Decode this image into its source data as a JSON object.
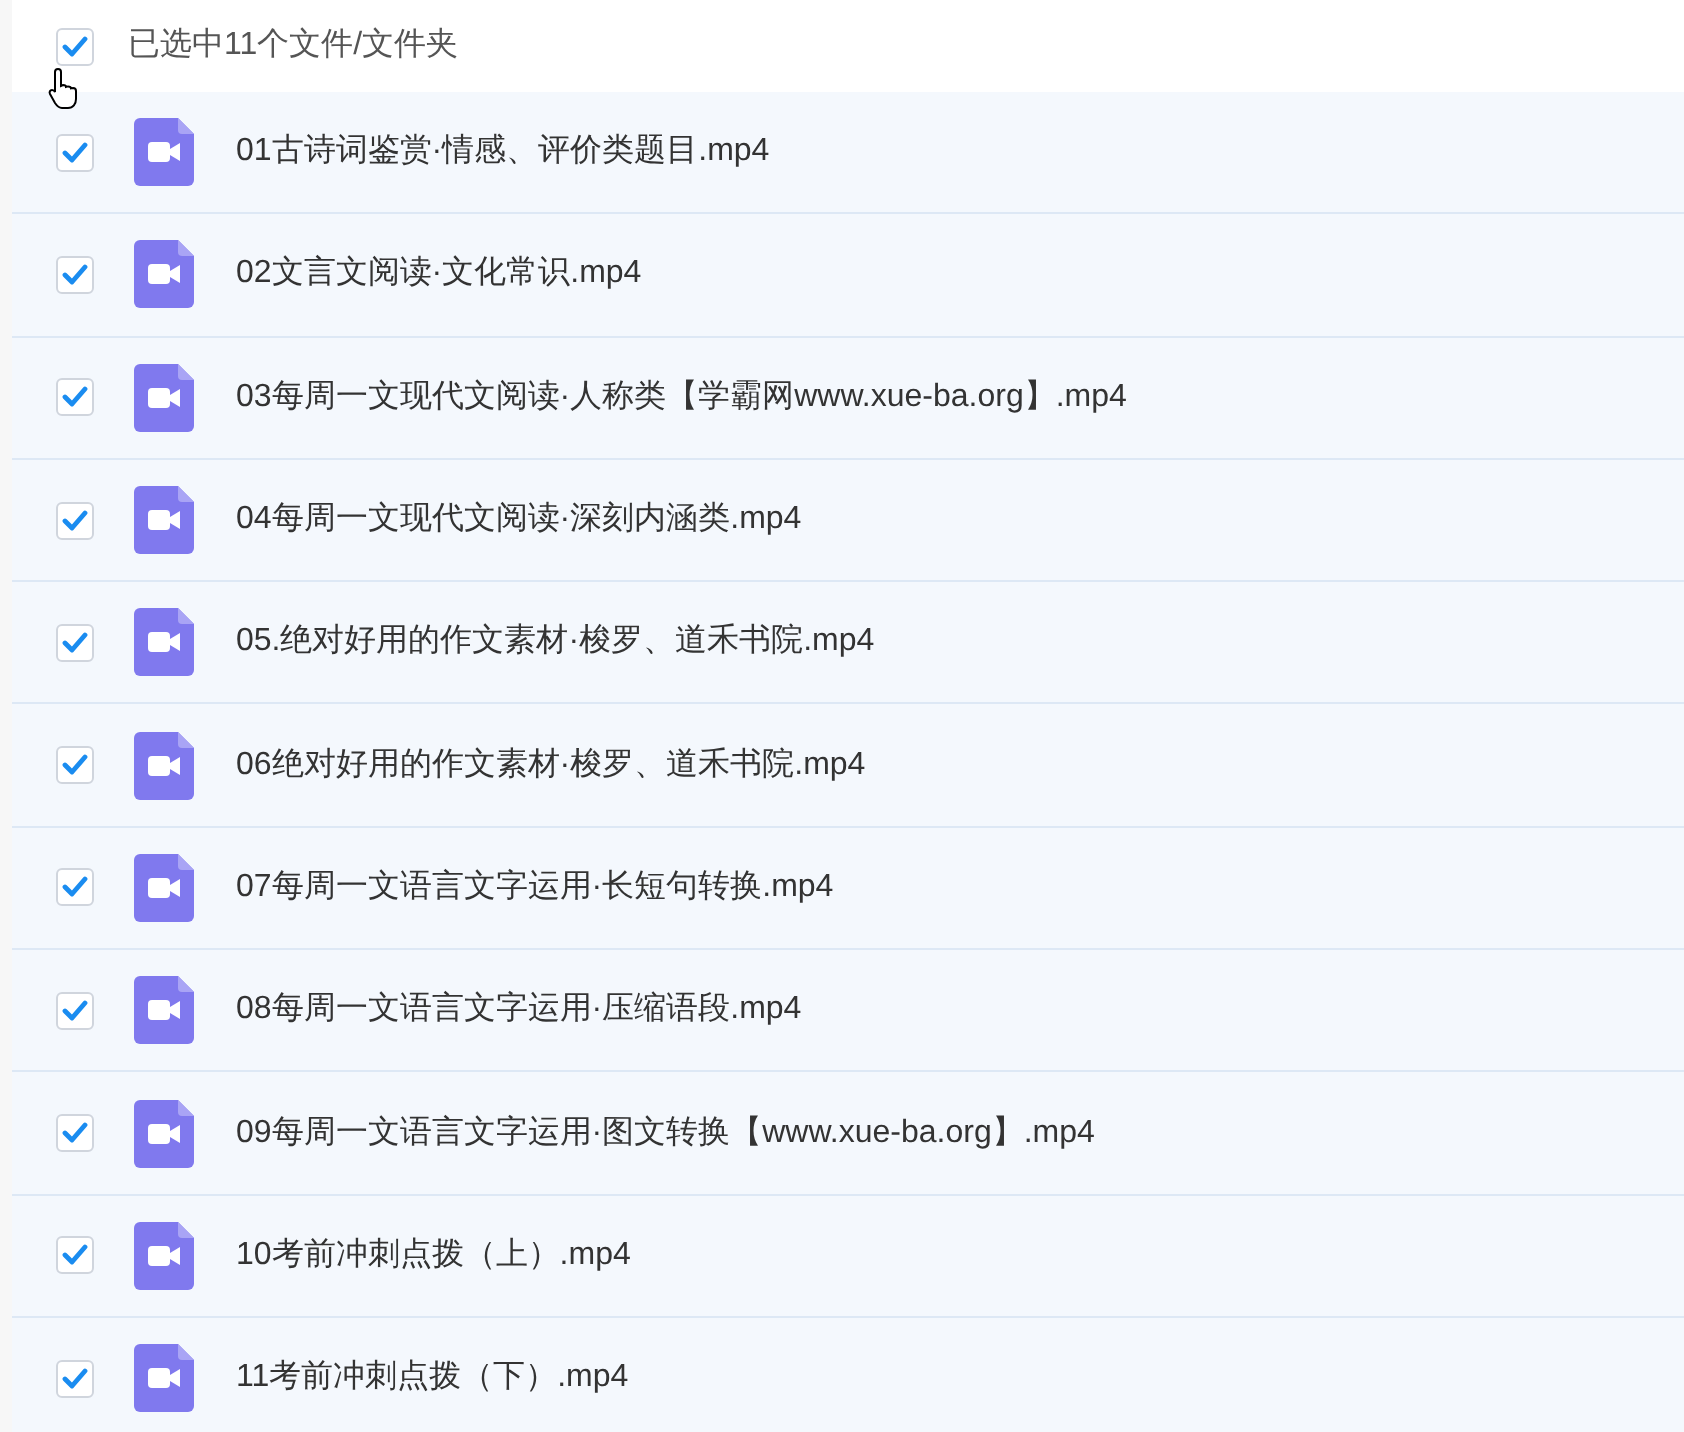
{
  "header": {
    "label": "已选中11个文件/文件夹",
    "checked": true
  },
  "files": [
    {
      "name": "01古诗词鉴赏·情感、评价类题目.mp4",
      "checked": true
    },
    {
      "name": "02文言文阅读·文化常识.mp4",
      "checked": true
    },
    {
      "name": "03每周一文现代文阅读·人称类【学霸网www.xue-ba.org】.mp4",
      "checked": true
    },
    {
      "name": "04每周一文现代文阅读·深刻内涵类.mp4",
      "checked": true
    },
    {
      "name": "05.绝对好用的作文素材·梭罗、道禾书院.mp4",
      "checked": true
    },
    {
      "name": "06绝对好用的作文素材·梭罗、道禾书院.mp4",
      "checked": true
    },
    {
      "name": "07每周一文语言文字运用·长短句转换.mp4",
      "checked": true
    },
    {
      "name": "08每周一文语言文字运用·压缩语段.mp4",
      "checked": true
    },
    {
      "name": "09每周一文语言文字运用·图文转换【www.xue-ba.org】.mp4",
      "checked": true
    },
    {
      "name": "10考前冲刺点拨（上）.mp4",
      "checked": true
    },
    {
      "name": "11考前冲刺点拨（下）.mp4",
      "checked": true
    }
  ]
}
